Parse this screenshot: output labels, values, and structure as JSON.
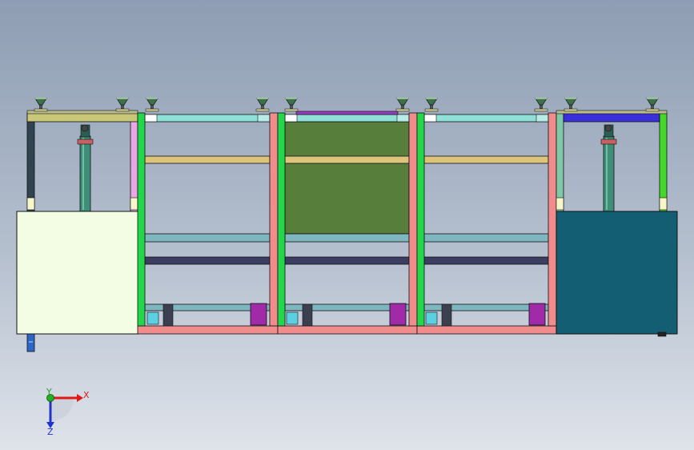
{
  "viewport": {
    "axis_x_label": "X",
    "axis_y_label": "Y",
    "axis_z_label": "Z"
  },
  "colors": {
    "frame_green": "#22d84a",
    "frame_pink": "#f08c8c",
    "panel_green": "#587e3c",
    "left_cabinet": "#f3fde4",
    "right_cabinet": "#135e72",
    "top_beam_cyan": "#8fe0d6",
    "shelf_tan": "#dcc47a",
    "rail_teal": "#7fb7c0",
    "tray_navy": "#3c3d63",
    "motor_purple": "#a02aa8"
  }
}
